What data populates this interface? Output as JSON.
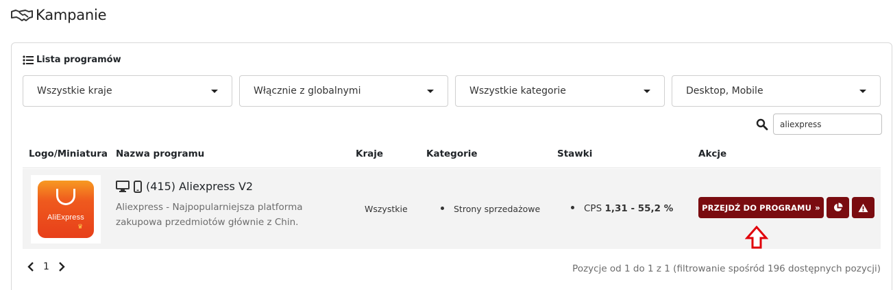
{
  "page": {
    "title": "Kampanie",
    "icon": "handshake-icon"
  },
  "card": {
    "title": "Lista programów",
    "icon": "list-icon"
  },
  "filters": {
    "countries": "Wszystkie kraje",
    "global": "Włącznie z globalnymi",
    "categories": "Wszystkie kategorie",
    "devices": "Desktop, Mobile"
  },
  "search": {
    "value": "aliexpress",
    "icon": "search-icon"
  },
  "table": {
    "headers": {
      "logo": "Logo/Miniatura",
      "name": "Nazwa programu",
      "countries": "Kraje",
      "categories": "Kategorie",
      "rates": "Stawki",
      "actions": "Akcje"
    },
    "rows": [
      {
        "logo_text": "AliExpress",
        "device_icons": [
          "desktop-icon",
          "mobile-icon"
        ],
        "title": "(415) Aliexpress V2",
        "description": "Aliexpress - Najpopularniejsza platforma zakupowa przedmiotów głównie z Chin.",
        "countries": "Wszystkie",
        "category": "Strony sprzedażowe",
        "rate_label": "CPS",
        "rate_value": "1,31 - 55,2 %",
        "go_button": "PRZEJDŹ DO PROGRAMU",
        "stats_icon": "pie-chart-icon",
        "warn_icon": "warning-icon"
      }
    ]
  },
  "pagination": {
    "current": "1"
  },
  "info_text": "Pozycje od 1 do 1 z 1 (filtrowanie spośród 196 dostępnych pozycji)",
  "colors": {
    "button": "#7a0c10",
    "annotation_arrow": "#e0000a"
  }
}
